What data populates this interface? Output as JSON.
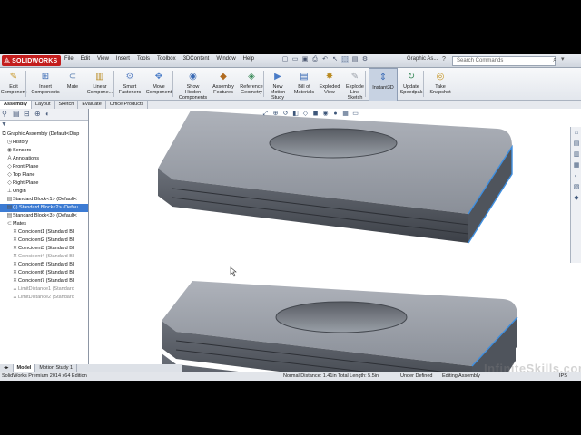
{
  "app": {
    "logo_text": "SOLIDWORKS",
    "menu": [
      "File",
      "Edit",
      "View",
      "Insert",
      "Tools",
      "Toolbox",
      "3DContent",
      "Window",
      "Help"
    ],
    "document_title": "Graphic As...",
    "search_placeholder": "Search Commands"
  },
  "commands": [
    {
      "label": "Edit\nComponent",
      "icon": "edit-component-icon"
    },
    {
      "label": "Insert\nComponents",
      "icon": "insert-components-icon"
    },
    {
      "label": "Mate",
      "icon": "mate-icon"
    },
    {
      "label": "Linear\nCompone...",
      "icon": "linear-pattern-icon"
    },
    {
      "label": "Smart\nFasteners",
      "icon": "smart-fasteners-icon"
    },
    {
      "label": "Move\nComponent",
      "icon": "move-component-icon"
    },
    {
      "label": "Show\nHidden\nComponents",
      "icon": "show-hidden-icon"
    },
    {
      "label": "Assembly\nFeatures",
      "icon": "assembly-features-icon"
    },
    {
      "label": "Reference\nGeometry",
      "icon": "reference-geometry-icon"
    },
    {
      "label": "New\nMotion\nStudy",
      "icon": "motion-study-icon"
    },
    {
      "label": "Bill of\nMaterials",
      "icon": "bom-icon"
    },
    {
      "label": "Exploded\nView",
      "icon": "exploded-view-icon"
    },
    {
      "label": "Explode\nLine\nSketch",
      "icon": "explode-line-icon"
    },
    {
      "label": "Instant3D",
      "icon": "instant3d-icon"
    },
    {
      "label": "Update\nSpeedpak",
      "icon": "speedpak-icon"
    },
    {
      "label": "Take\nSnapshot",
      "icon": "snapshot-icon"
    }
  ],
  "tabs": [
    "Assembly",
    "Layout",
    "Sketch",
    "Evaluate",
    "Office Products"
  ],
  "active_tab": "Assembly",
  "tree": [
    {
      "label": "Graphic Assembly  (Default<Disp",
      "icon": "assembly-icon",
      "state": "normal"
    },
    {
      "label": "History",
      "icon": "history-icon",
      "state": "normal"
    },
    {
      "label": "Sensors",
      "icon": "sensors-icon",
      "state": "normal"
    },
    {
      "label": "Annotations",
      "icon": "annotations-icon",
      "state": "normal"
    },
    {
      "label": "Front Plane",
      "icon": "plane-icon",
      "state": "normal"
    },
    {
      "label": "Top Plane",
      "icon": "plane-icon",
      "state": "normal"
    },
    {
      "label": "Right Plane",
      "icon": "plane-icon",
      "state": "normal"
    },
    {
      "label": "Origin",
      "icon": "origin-icon",
      "state": "normal"
    },
    {
      "label": "Standard Block<1> (Default<",
      "icon": "part-icon",
      "state": "normal"
    },
    {
      "label": "(-) Standard Block<2> (Defau",
      "icon": "part-icon",
      "state": "selected"
    },
    {
      "label": "Standard Block<3> (Default<",
      "icon": "part-icon",
      "state": "normal"
    },
    {
      "label": "Mates",
      "icon": "mates-icon",
      "state": "normal"
    },
    {
      "label": "Coincident1 (Standard Bl",
      "icon": "coincident-icon",
      "state": "normal"
    },
    {
      "label": "Coincident2 (Standard Bl",
      "icon": "coincident-icon",
      "state": "normal"
    },
    {
      "label": "Coincident3 (Standard Bl",
      "icon": "coincident-icon",
      "state": "normal"
    },
    {
      "label": "Coincident4 (Standard Bl",
      "icon": "coincident-icon",
      "state": "suppressed"
    },
    {
      "label": "Coincident5 (Standard Bl",
      "icon": "coincident-icon",
      "state": "normal"
    },
    {
      "label": "Coincident6 (Standard Bl",
      "icon": "coincident-icon",
      "state": "normal"
    },
    {
      "label": "Coincident7 (Standard Bl",
      "icon": "coincident-icon",
      "state": "normal"
    },
    {
      "label": "LimitDistance1 (Standard",
      "icon": "limit-distance-icon",
      "state": "suppressed"
    },
    {
      "label": "LimitDistance2 (Standard",
      "icon": "limit-distance-icon",
      "state": "suppressed"
    }
  ],
  "bottom_tabs": [
    "Model",
    "Motion Study 1"
  ],
  "status": {
    "product": "SolidWorks Premium 2014 x64 Edition",
    "measure": "Normal Distance: 1.41in  Total Length: 5.5in",
    "definition": "Under Defined",
    "mode": "Editing Assembly",
    "units": "IPS"
  },
  "watermark": "InfiniteSkills.com",
  "colors": {
    "selection": "#3c7bd3",
    "part_face": "#8a8f99",
    "edge_highlight": "#3f8fe0"
  }
}
